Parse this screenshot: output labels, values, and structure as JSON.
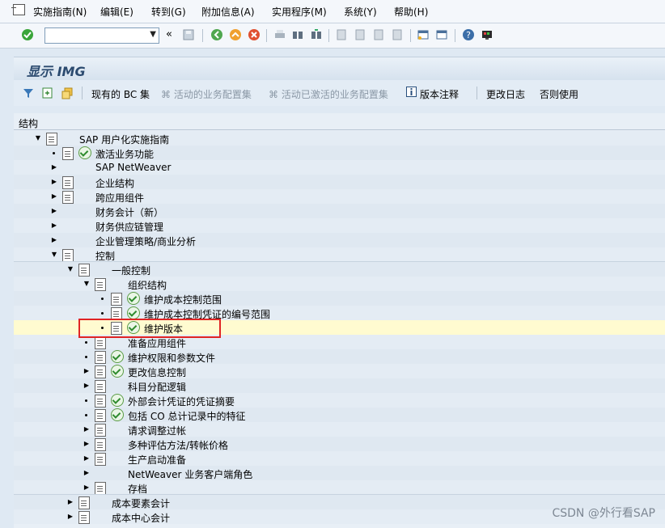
{
  "menu": [
    "实施指南(N)",
    "编辑(E)",
    "转到(G)",
    "附加信息(A)",
    "实用程序(M)",
    "系统(Y)",
    "帮助(H)"
  ],
  "toolbar": {
    "back_chevrons": "«"
  },
  "screen_title": "显示 IMG",
  "app_toolbar": {
    "existing_bc": "现有的 BC 集",
    "active_bc": "活动的业务配置集",
    "activated_bc": "活动已激活的业务配置集",
    "version_notes": "版本注释",
    "change_log": "更改日志",
    "not_used": "否则使用"
  },
  "tree": {
    "header": "结构",
    "nodes": [
      {
        "label": "SAP 用户化实施指南",
        "level": 0,
        "expander": "open",
        "doc": true,
        "exec": false
      },
      {
        "label": "激活业务功能",
        "level": 1,
        "expander": "leaf",
        "doc": true,
        "exec": true
      },
      {
        "label": "SAP NetWeaver",
        "level": 1,
        "expander": "closed",
        "doc": false,
        "exec": false
      },
      {
        "label": "企业结构",
        "level": 1,
        "expander": "closed",
        "doc": true,
        "exec": false
      },
      {
        "label": "跨应用组件",
        "level": 1,
        "expander": "closed",
        "doc": true,
        "exec": false
      },
      {
        "label": "财务会计（新）",
        "level": 1,
        "expander": "closed",
        "doc": false,
        "exec": false
      },
      {
        "label": "财务供应链管理",
        "level": 1,
        "expander": "closed",
        "doc": false,
        "exec": false
      },
      {
        "label": "企业管理策略/商业分析",
        "level": 1,
        "expander": "closed",
        "doc": false,
        "exec": false
      },
      {
        "label": "控制",
        "level": 1,
        "expander": "open",
        "doc": true,
        "exec": false
      },
      {
        "label": "一般控制",
        "level": 2,
        "expander": "open",
        "doc": true,
        "exec": false
      },
      {
        "label": "组织结构",
        "level": 3,
        "expander": "open",
        "doc": true,
        "exec": false
      },
      {
        "label": "维护成本控制范围",
        "level": 4,
        "expander": "leaf",
        "doc": true,
        "exec": true
      },
      {
        "label": "维护成本控制凭证的编号范围",
        "level": 4,
        "expander": "leaf",
        "doc": true,
        "exec": true
      },
      {
        "label": "维护版本",
        "level": 4,
        "expander": "leaf",
        "doc": true,
        "exec": true
      },
      {
        "label": "准备应用组件",
        "level": 3,
        "expander": "leaf",
        "doc": true,
        "exec": false
      },
      {
        "label": "维护权限和参数文件",
        "level": 3,
        "expander": "leaf",
        "doc": true,
        "exec": true
      },
      {
        "label": "更改信息控制",
        "level": 3,
        "expander": "closed",
        "doc": true,
        "exec": true
      },
      {
        "label": "科目分配逻辑",
        "level": 3,
        "expander": "closed",
        "doc": true,
        "exec": false
      },
      {
        "label": "外部会计凭证的凭证摘要",
        "level": 3,
        "expander": "leaf",
        "doc": true,
        "exec": true
      },
      {
        "label": "包括 CO 总计记录中的特征",
        "level": 3,
        "expander": "leaf",
        "doc": true,
        "exec": true
      },
      {
        "label": "请求调整过帐",
        "level": 3,
        "expander": "closed",
        "doc": true,
        "exec": false
      },
      {
        "label": "多种评估方法/转帐价格",
        "level": 3,
        "expander": "closed",
        "doc": true,
        "exec": false
      },
      {
        "label": "生产启动准备",
        "level": 3,
        "expander": "closed",
        "doc": true,
        "exec": false
      },
      {
        "label": "NetWeaver 业务客户端角色",
        "level": 3,
        "expander": "closed",
        "doc": false,
        "exec": false
      },
      {
        "label": "存档",
        "level": 3,
        "expander": "closed",
        "doc": true,
        "exec": false
      },
      {
        "label": "成本要素会计",
        "level": 2,
        "expander": "closed",
        "doc": true,
        "exec": false
      },
      {
        "label": "成本中心会计",
        "level": 2,
        "expander": "closed",
        "doc": true,
        "exec": false
      }
    ]
  },
  "watermark": "CSDN @外行看SAP"
}
